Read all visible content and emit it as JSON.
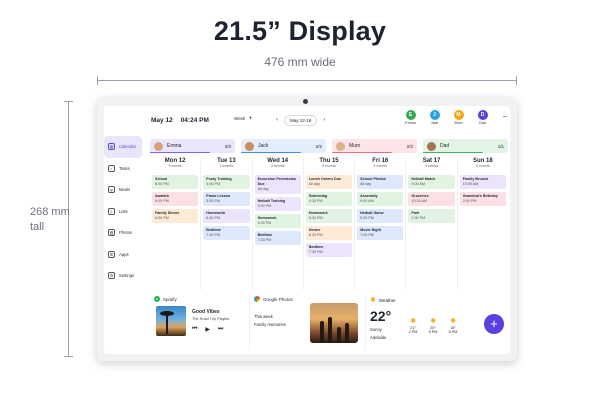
{
  "header": {
    "title": "21.5” Display",
    "width_label": "476 mm wide",
    "height_label_1": "268 mm",
    "height_label_2": "tall"
  },
  "topbar": {
    "date": "May 12",
    "time": "04:24 PM",
    "view": "Week",
    "week_range": "May 12-18"
  },
  "family": [
    {
      "name": "Emma",
      "initial": "E",
      "color": "#34a853"
    },
    {
      "name": "Jack",
      "initial": "J",
      "color": "#29a3e0"
    },
    {
      "name": "Mum",
      "initial": "M",
      "color": "#f2a516"
    },
    {
      "name": "Dad",
      "initial": "D",
      "color": "#5b3fe0"
    }
  ],
  "sidebar": [
    {
      "label": "Calendar",
      "icon": "calendar-icon"
    },
    {
      "label": "Tasks",
      "icon": "check-icon"
    },
    {
      "label": "Meals",
      "icon": "fork-icon"
    },
    {
      "label": "Lists",
      "icon": "list-icon"
    },
    {
      "label": "Photos",
      "icon": "image-icon"
    },
    {
      "label": "Apps",
      "icon": "grid-icon"
    },
    {
      "label": "Settings",
      "icon": "gear-icon"
    }
  ],
  "people_bars": [
    {
      "name": "Emma",
      "count": "3/3",
      "bg": "#ebe6fb",
      "line": "#7b61ff",
      "pic": "#d9a27a"
    },
    {
      "name": "Jack",
      "count": "2/2",
      "bg": "#e3eefc",
      "line": "#3f8cf0",
      "pic": "#c98f5e"
    },
    {
      "name": "Mum",
      "count": "2/2",
      "bg": "#fde4e8",
      "line": "#ef6a84",
      "pic": "#e0b08a"
    },
    {
      "name": "Dad",
      "count": "1/1",
      "bg": "#e2f4e3",
      "line": "#43b35a",
      "pic": "#a87552"
    }
  ],
  "days": [
    {
      "name": "Mon 12",
      "count": "3 events",
      "events": [
        {
          "title": "School",
          "time": "8:00 PM",
          "c": "e-green"
        },
        {
          "title": "Awatick",
          "time": "6:00 PM",
          "c": "e-pink"
        },
        {
          "title": "Family Dinner",
          "time": "6:00 PM",
          "c": "e-orange"
        }
      ]
    },
    {
      "name": "Tue 13",
      "count": "3 events",
      "events": [
        {
          "title": "Footy Training",
          "time": "4:00 PM",
          "c": "e-green"
        },
        {
          "title": "Piano Lesson",
          "time": "5:30 PM",
          "c": "e-blue"
        },
        {
          "title": "Homework",
          "time": "6:30 PM",
          "c": "e-purple"
        },
        {
          "title": "Bedtime",
          "time": "7:30 PM",
          "c": "e-blue"
        }
      ]
    },
    {
      "name": "Wed 14",
      "count": "4 events",
      "events": [
        {
          "title": "Excursion Permission Due",
          "time": "All day",
          "c": "e-purple"
        },
        {
          "title": "Netball Training",
          "time": "4:00 PM",
          "c": "e-purple"
        },
        {
          "title": "Homework",
          "time": "6:30 PM",
          "c": "e-green"
        },
        {
          "title": "Bedtime",
          "time": "7:30 PM",
          "c": "e-blue"
        }
      ]
    },
    {
      "name": "Thu 15",
      "count": "5 events",
      "events": [
        {
          "title": "Lunch Orders Due",
          "time": "All day",
          "c": "e-orange"
        },
        {
          "title": "Swimming",
          "time": "4:30 PM",
          "c": "e-green"
        },
        {
          "title": "Homework",
          "time": "6:30 PM",
          "c": "e-green"
        },
        {
          "title": "Dinner",
          "time": "6:30 PM",
          "c": "e-orange"
        },
        {
          "title": "Bedtime",
          "time": "7:30 PM",
          "c": "e-purple"
        }
      ]
    },
    {
      "name": "Fri 16",
      "count": "4 events",
      "events": [
        {
          "title": "School Photos",
          "time": "All day",
          "c": "e-blue"
        },
        {
          "title": "Assembly",
          "time": "9:00 AM",
          "c": "e-green"
        },
        {
          "title": "Netball Game",
          "time": "5:30 PM",
          "c": "e-blue"
        },
        {
          "title": "Movie Night",
          "time": "7:00 PM",
          "c": "e-blue"
        }
      ]
    },
    {
      "name": "Sat 17",
      "count": "4 events",
      "events": [
        {
          "title": "Netball Match",
          "time": "9:00 AM",
          "c": "e-green"
        },
        {
          "title": "Groceries",
          "time": "10:30 AM",
          "c": "e-pink"
        },
        {
          "title": "Park",
          "time": "2:30 PM",
          "c": "e-green"
        }
      ]
    },
    {
      "name": "Sun 18",
      "count": "3 events",
      "events": [
        {
          "title": "Family Brunch",
          "time": "10:00 AM",
          "c": "e-purple"
        },
        {
          "title": "Grandma's Birthday",
          "time": "2:00 PM",
          "c": "e-pink"
        }
      ]
    }
  ],
  "spotify": {
    "label": "Spotify",
    "song": "Good Vibes",
    "artist": "The Road Trip Playlist"
  },
  "photos": {
    "label": "Google Photos",
    "line1": "This week",
    "line2": "Family memories"
  },
  "weather": {
    "label": "Weather",
    "temp": "22°",
    "condition": "Sunny",
    "city": "Adelaide",
    "forecast": [
      {
        "t": "21°",
        "h": "2 PM"
      },
      {
        "t": "20°",
        "h": "5 PM"
      },
      {
        "t": "18°",
        "h": "8 PM"
      }
    ]
  },
  "fab": "+"
}
